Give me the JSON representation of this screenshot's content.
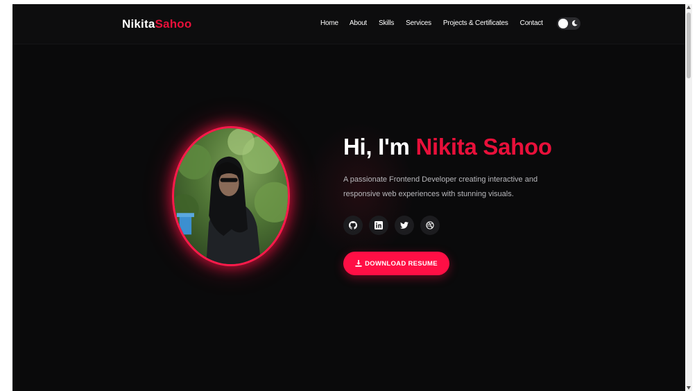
{
  "header": {
    "logo_first": "Nikita",
    "logo_second": "Sahoo",
    "nav": [
      {
        "label": "Home"
      },
      {
        "label": "About"
      },
      {
        "label": "Skills"
      },
      {
        "label": "Services"
      },
      {
        "label": "Projects & Certificates"
      },
      {
        "label": "Contact"
      }
    ],
    "theme_toggle_icon": "moon-icon"
  },
  "hero": {
    "greeting": "Hi, I'm",
    "name": "Nikita Sahoo",
    "description": "A passionate Frontend Developer creating interactive and responsive web experiences with stunning visuals.",
    "socials": [
      {
        "icon": "github-icon"
      },
      {
        "icon": "linkedin-icon"
      },
      {
        "icon": "twitter-icon"
      },
      {
        "icon": "dribbble-icon"
      }
    ],
    "download_label": "DOWNLOAD RESUME",
    "download_icon": "download-icon"
  },
  "colors": {
    "accent": "#e8103a",
    "button": "#ff0f45",
    "background": "#0a0a0b"
  }
}
